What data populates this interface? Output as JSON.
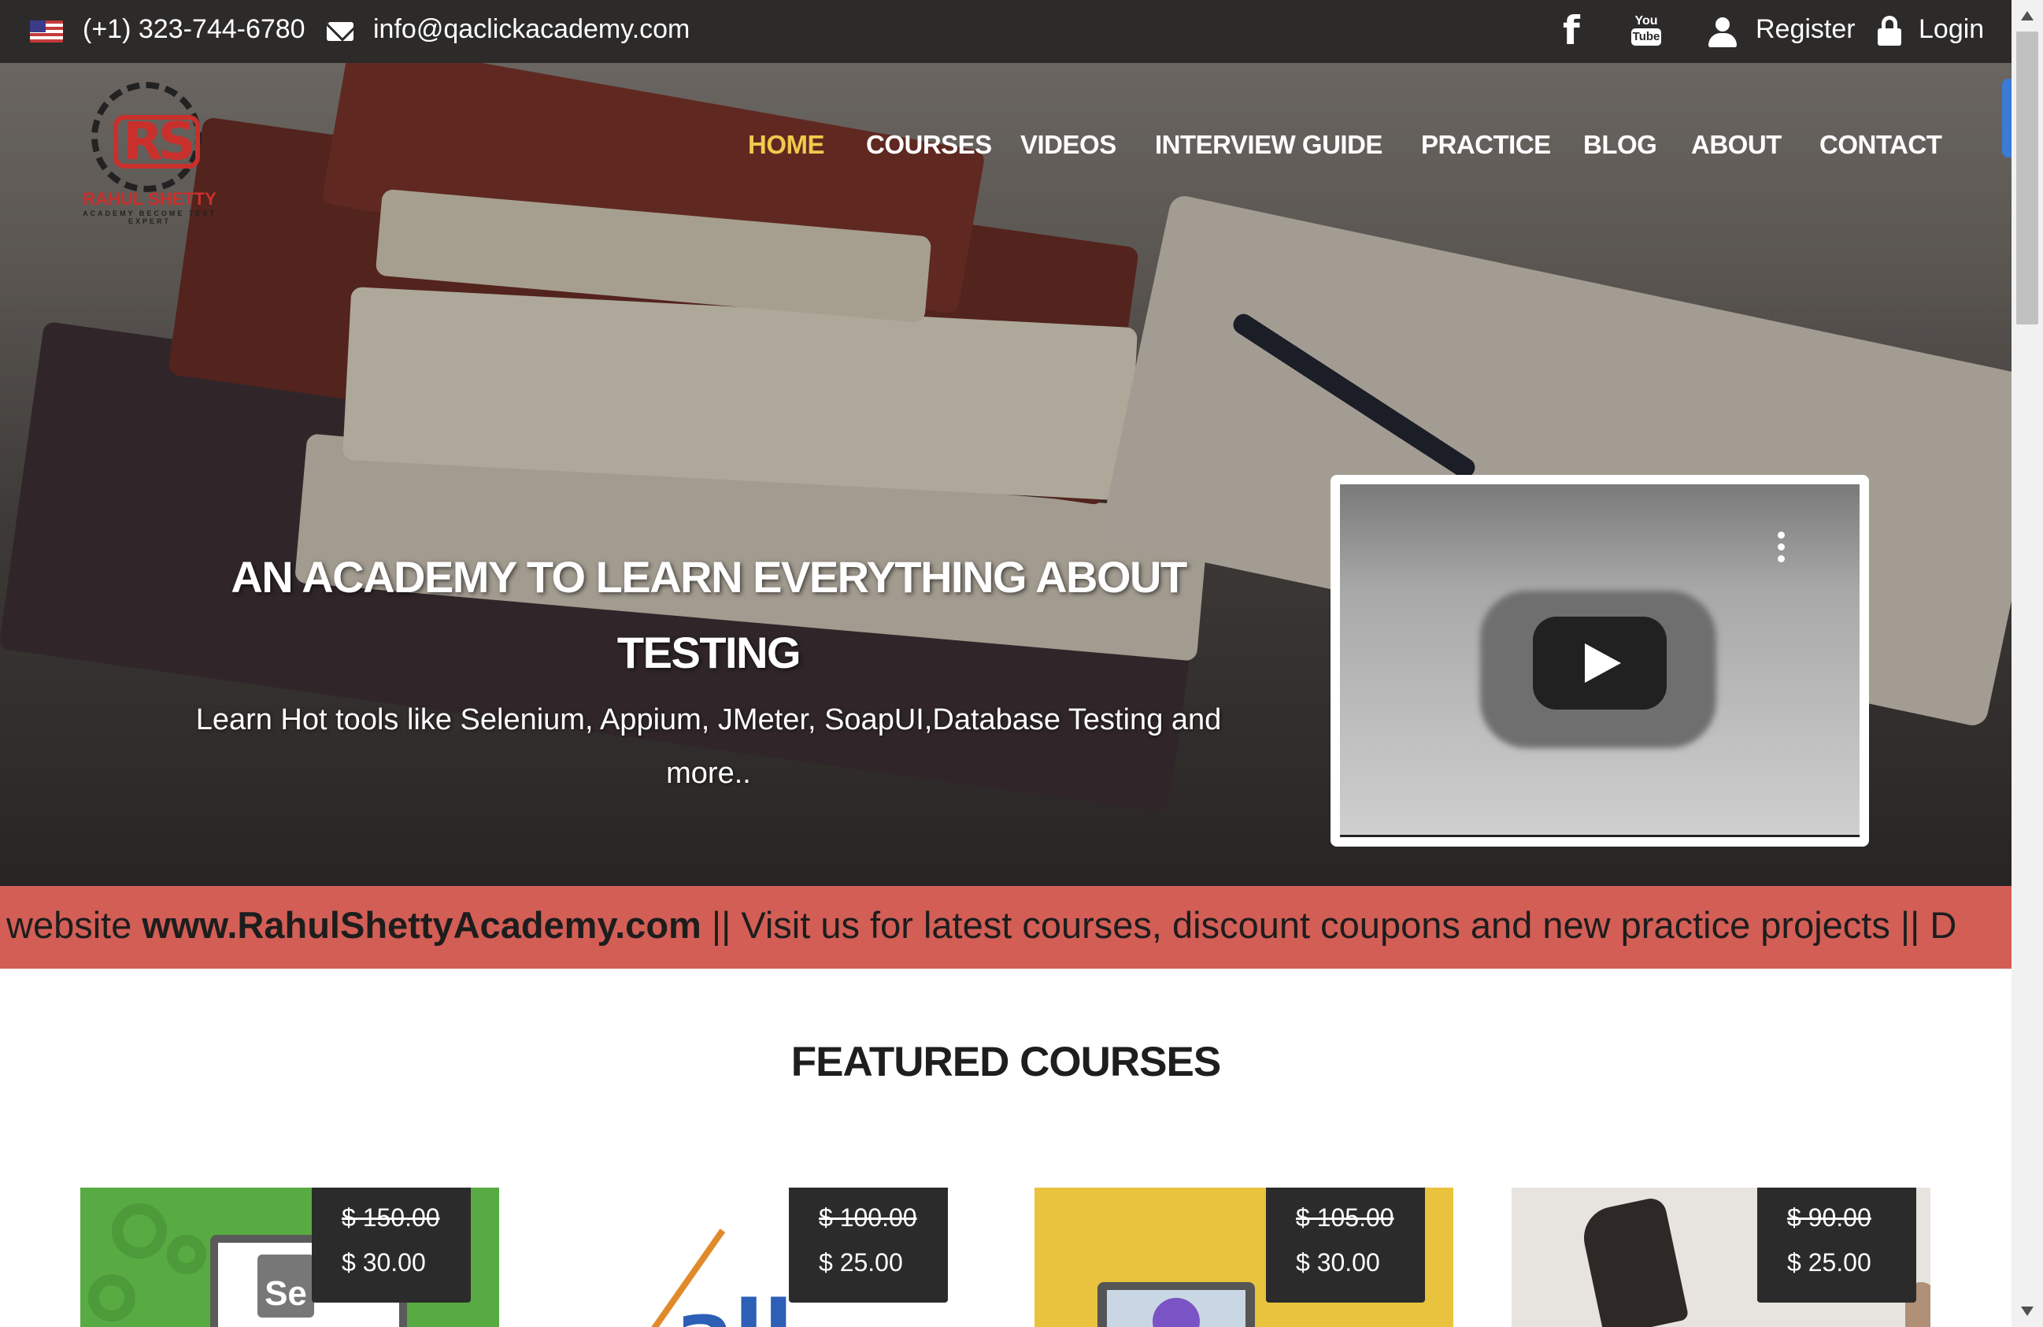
{
  "topbar": {
    "phone": "(+1) 323-744-6780",
    "email": "info@qaclickacademy.com",
    "youtube_top": "You",
    "youtube_bottom": "Tube",
    "facebook_glyph": "f",
    "register": "Register",
    "login": "Login"
  },
  "logo": {
    "mark": "RS",
    "name": "RAHUL SHETTY",
    "subtitle": "ACADEMY",
    "tagline": "BECOME TEST EXPERT"
  },
  "nav": {
    "items": [
      "HOME",
      "COURSES",
      "VIDEOS",
      "INTERVIEW GUIDE",
      "PRACTICE",
      "BLOG",
      "ABOUT",
      "CONTACT"
    ],
    "active": "HOME"
  },
  "hero": {
    "title": "AN ACADEMY TO LEARN EVERYTHING ABOUT TESTING",
    "subtitle": "Learn Hot tools like Selenium, Appium, JMeter, SoapUI,Database Testing and more.."
  },
  "marquee": {
    "prefix": "website ",
    "link": "www.RahulShettyAcademy.com",
    "suffix": " || Visit us for latest courses, discount coupons and new practice projects || D"
  },
  "featured": {
    "title": "FEATURED COURSES",
    "courses": [
      {
        "old_price": "$ 150.00",
        "new_price": "$ 30.00",
        "art_text": "Se"
      },
      {
        "old_price": "$ 100.00",
        "new_price": "$ 25.00",
        "art_text": "all"
      },
      {
        "old_price": "$ 105.00",
        "new_price": "$ 30.00"
      },
      {
        "old_price": "$ 90.00",
        "new_price": "$ 25.00"
      }
    ]
  },
  "colors": {
    "topbar_bg": "#2d2b2a",
    "nav_active": "#f2c94c",
    "marquee_bg": "#d25e56",
    "brand_red": "#c9302c"
  },
  "icons": [
    "us-flag-icon",
    "envelope-icon",
    "facebook-icon",
    "youtube-icon",
    "user-icon",
    "lock-icon",
    "play-icon",
    "more-vert-icon"
  ]
}
